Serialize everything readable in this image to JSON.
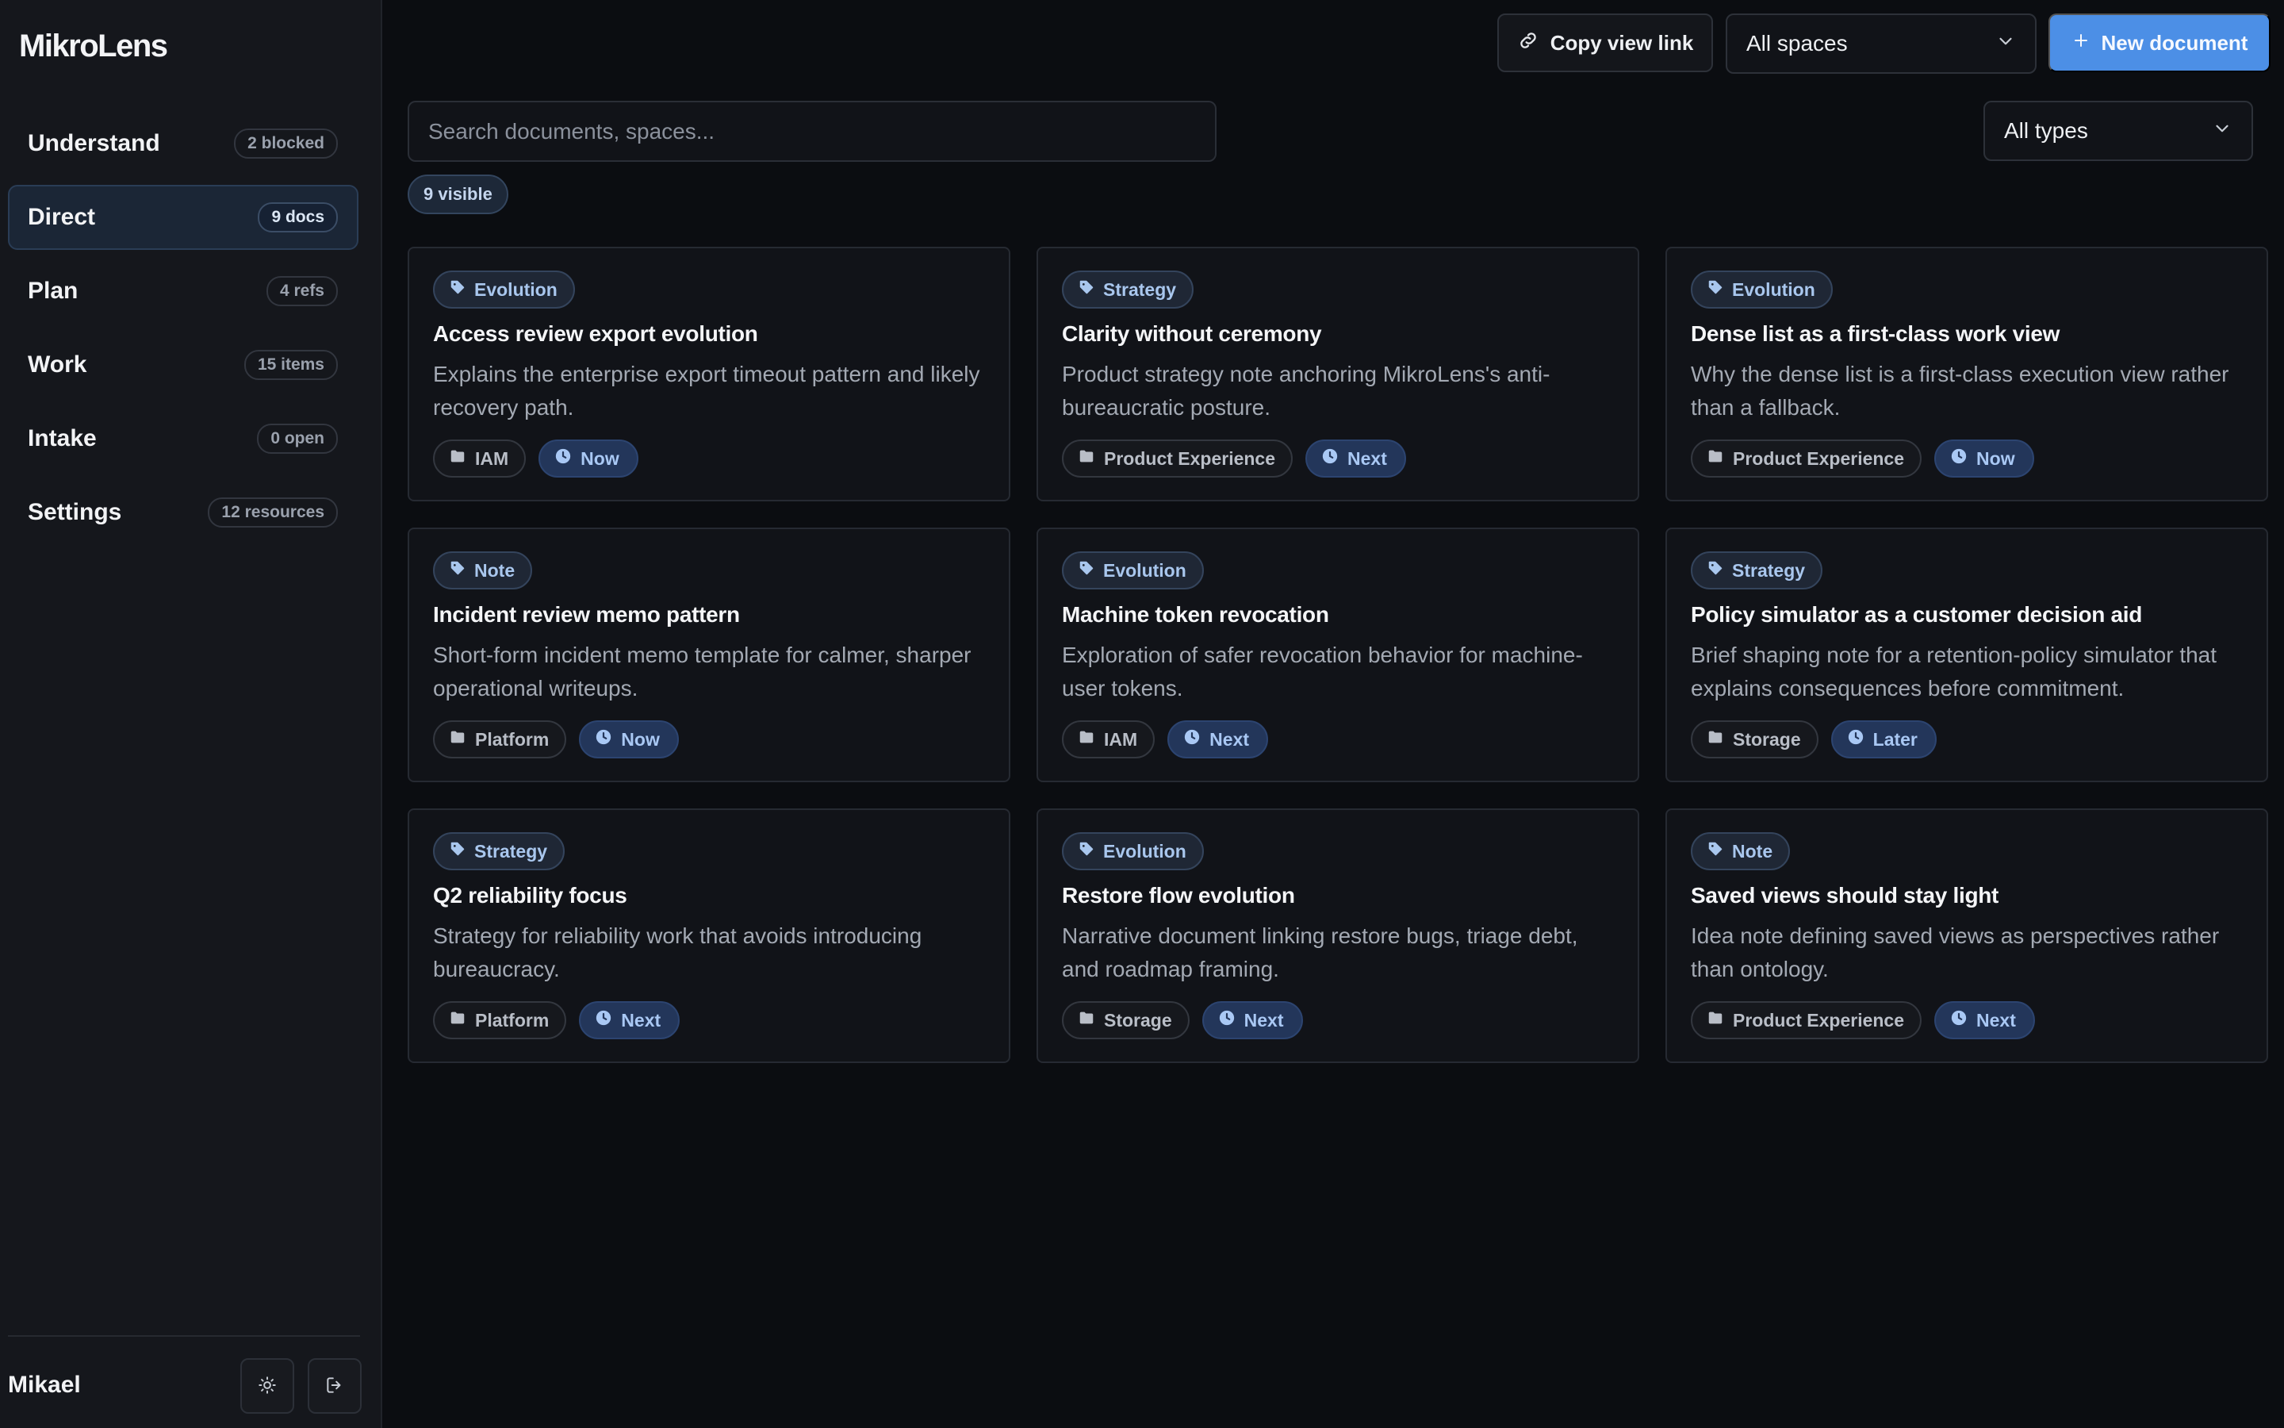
{
  "app": {
    "brand": "MikroLens"
  },
  "sidebar": {
    "items": [
      {
        "label": "Understand",
        "badge": "2 blocked",
        "active": false
      },
      {
        "label": "Direct",
        "badge": "9 docs",
        "active": true
      },
      {
        "label": "Plan",
        "badge": "4 refs",
        "active": false
      },
      {
        "label": "Work",
        "badge": "15 items",
        "active": false
      },
      {
        "label": "Intake",
        "badge": "0 open",
        "active": false
      },
      {
        "label": "Settings",
        "badge": "12 resources",
        "active": false
      }
    ],
    "user": "Mikael",
    "theme_icon": "sun-icon",
    "logout_icon": "logout-icon"
  },
  "toolbar": {
    "copy_label": "Copy view link",
    "spaces_select": "All spaces",
    "new_label": "New document",
    "search_placeholder": "Search documents, spaces...",
    "types_select": "All types",
    "visible_count": "9 visible"
  },
  "colors": {
    "accent": "#4c8fe6",
    "background": "#0b0d11",
    "sidebar": "#15171c",
    "card": "#111318"
  },
  "documents": [
    {
      "type": "Evolution",
      "title": "Access review export evolution",
      "desc": "Explains the enterprise export timeout pattern and likely recovery path.",
      "space": "IAM",
      "horizon": "Now"
    },
    {
      "type": "Strategy",
      "title": "Clarity without ceremony",
      "desc": "Product strategy note anchoring MikroLens's anti-bureaucratic posture.",
      "space": "Product Experience",
      "horizon": "Next"
    },
    {
      "type": "Evolution",
      "title": "Dense list as a first-class work view",
      "desc": "Why the dense list is a first-class execution view rather than a fallback.",
      "space": "Product Experience",
      "horizon": "Now"
    },
    {
      "type": "Note",
      "title": "Incident review memo pattern",
      "desc": "Short-form incident memo template for calmer, sharper operational writeups.",
      "space": "Platform",
      "horizon": "Now"
    },
    {
      "type": "Evolution",
      "title": "Machine token revocation",
      "desc": "Exploration of safer revocation behavior for machine-user tokens.",
      "space": "IAM",
      "horizon": "Next"
    },
    {
      "type": "Strategy",
      "title": "Policy simulator as a customer decision aid",
      "desc": "Brief shaping note for a retention-policy simulator that explains consequences before commitment.",
      "space": "Storage",
      "horizon": "Later"
    },
    {
      "type": "Strategy",
      "title": "Q2 reliability focus",
      "desc": "Strategy for reliability work that avoids introducing bureaucracy.",
      "space": "Platform",
      "horizon": "Next"
    },
    {
      "type": "Evolution",
      "title": "Restore flow evolution",
      "desc": "Narrative document linking restore bugs, triage debt, and roadmap framing.",
      "space": "Storage",
      "horizon": "Next"
    },
    {
      "type": "Note",
      "title": "Saved views should stay light",
      "desc": "Idea note defining saved views as perspectives rather than ontology.",
      "space": "Product Experience",
      "horizon": "Next"
    }
  ]
}
